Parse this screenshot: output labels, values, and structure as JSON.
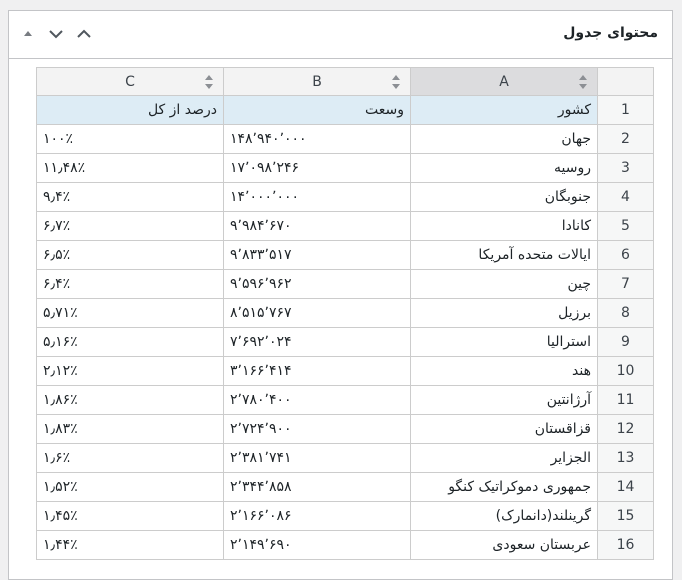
{
  "box": {
    "title": "محتوای جدول"
  },
  "columns": {
    "c": "C",
    "b": "B",
    "a": "A"
  },
  "rows": [
    {
      "n": "1",
      "a": "کشور",
      "b": "وسعت",
      "c": "درصد از کل"
    },
    {
      "n": "2",
      "a": "جهان",
      "b": "۱۴۸٬۹۴۰٬۰۰۰",
      "c": "۱۰۰٪"
    },
    {
      "n": "3",
      "a": "روسیه",
      "b": "۱۷٬۰۹۸٬۲۴۶",
      "c": "۱۱٫۴۸٪"
    },
    {
      "n": "4",
      "a": "جنوبگان",
      "b": "۱۴٬۰۰۰٬۰۰۰",
      "c": "۹٫۴٪"
    },
    {
      "n": "5",
      "a": "کانادا",
      "b": "۹٬۹۸۴٬۶۷۰",
      "c": "۶٫۷٪"
    },
    {
      "n": "6",
      "a": "ایالات متحده آمریکا",
      "b": "۹٬۸۳۳٬۵۱۷",
      "c": "۶٫۵٪"
    },
    {
      "n": "7",
      "a": "چین",
      "b": "۹٬۵۹۶٬۹۶۲",
      "c": "۶٫۴٪"
    },
    {
      "n": "8",
      "a": "برزیل",
      "b": "۸٬۵۱۵٬۷۶۷",
      "c": "۵٫۷۱٪"
    },
    {
      "n": "9",
      "a": "استرالیا",
      "b": "۷٬۶۹۲٬۰۲۴",
      "c": "۵٫۱۶٪"
    },
    {
      "n": "10",
      "a": "هند",
      "b": "۳٬۱۶۶٬۴۱۴",
      "c": "۲٫۱۲٪"
    },
    {
      "n": "11",
      "a": "آرژانتین",
      "b": "۲٬۷۸۰٬۴۰۰",
      "c": "۱٫۸۶٪"
    },
    {
      "n": "12",
      "a": "قزاقستان",
      "b": "۲٬۷۲۴٬۹۰۰",
      "c": "۱٫۸۳٪"
    },
    {
      "n": "13",
      "a": "الجزایر",
      "b": "۲٬۳۸۱٬۷۴۱",
      "c": "۱٫۶٪"
    },
    {
      "n": "14",
      "a": "جمهوری دموکراتیک کنگو",
      "b": "۲٬۳۴۴٬۸۵۸",
      "c": "۱٫۵۲٪"
    },
    {
      "n": "15",
      "a": "گرینلند(دانمارک)",
      "b": "۲٬۱۶۶٬۰۸۶",
      "c": "۱٫۴۵٪"
    },
    {
      "n": "16",
      "a": "عربستان سعودی",
      "b": "۲٬۱۴۹٬۶۹۰",
      "c": "۱٫۴۴٪"
    }
  ]
}
